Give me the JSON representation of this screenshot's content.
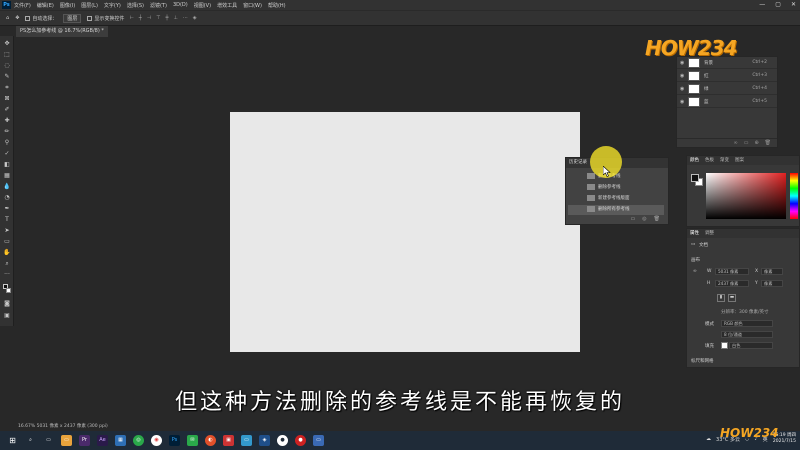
{
  "app": {
    "logo": "Ps"
  },
  "menu": [
    "文件(F)",
    "编辑(E)",
    "图像(I)",
    "图层(L)",
    "文字(Y)",
    "选择(S)",
    "滤镜(T)",
    "3D(D)",
    "视图(V)",
    "增效工具",
    "窗口(W)",
    "帮助(H)"
  ],
  "window_controls": {
    "min": "—",
    "max": "▢",
    "close": "✕"
  },
  "options": {
    "auto_select": "自动选择：",
    "auto_select_value": "图层",
    "show_transform": "显示变换控件"
  },
  "document_tab": "PS怎么加参考线 @ 16.7%(RGB/8) *",
  "layers": [
    {
      "name": "背景",
      "shortcut": "Ctrl+2"
    },
    {
      "name": "红",
      "shortcut": "Ctrl+3"
    },
    {
      "name": "绿",
      "shortcut": "Ctrl+4"
    },
    {
      "name": "蓝",
      "shortcut": "Ctrl+5"
    }
  ],
  "history": {
    "title": "历史记录",
    "items": [
      "删除参考线",
      "删除参考线",
      "新建参考线版面",
      "删除所有参考线"
    ]
  },
  "color_panel": {
    "tabs": [
      "颜色",
      "色板",
      "渐变",
      "图案"
    ]
  },
  "properties": {
    "tabs": [
      "属性",
      "调整"
    ],
    "doc_label": "文档",
    "canvas_label": "画布",
    "w_label": "W",
    "w_value": "5031 像素",
    "x_label": "X",
    "x_value": "像素",
    "h_label": "H",
    "h_value": "2437 像素",
    "y_label": "Y",
    "y_value": "像素",
    "resolution": "分辨率：300 像素/英寸",
    "mode_label": "模式",
    "mode_value": "RGB 颜色",
    "depth_value": "8 位/通道",
    "fill_label": "填充",
    "fill_value": "白色",
    "rulers_label": "标尺和网格"
  },
  "status": "16.67%   5031 像素 x 2437 像素 (300 ppi)",
  "subtitle": "但这种方法删除的参考线是不能再恢复的",
  "watermark": "HOW234",
  "tray": {
    "weather": "33°C  多云",
    "lang": "英",
    "time": "16:19 周四",
    "date": "2021/7/15"
  }
}
